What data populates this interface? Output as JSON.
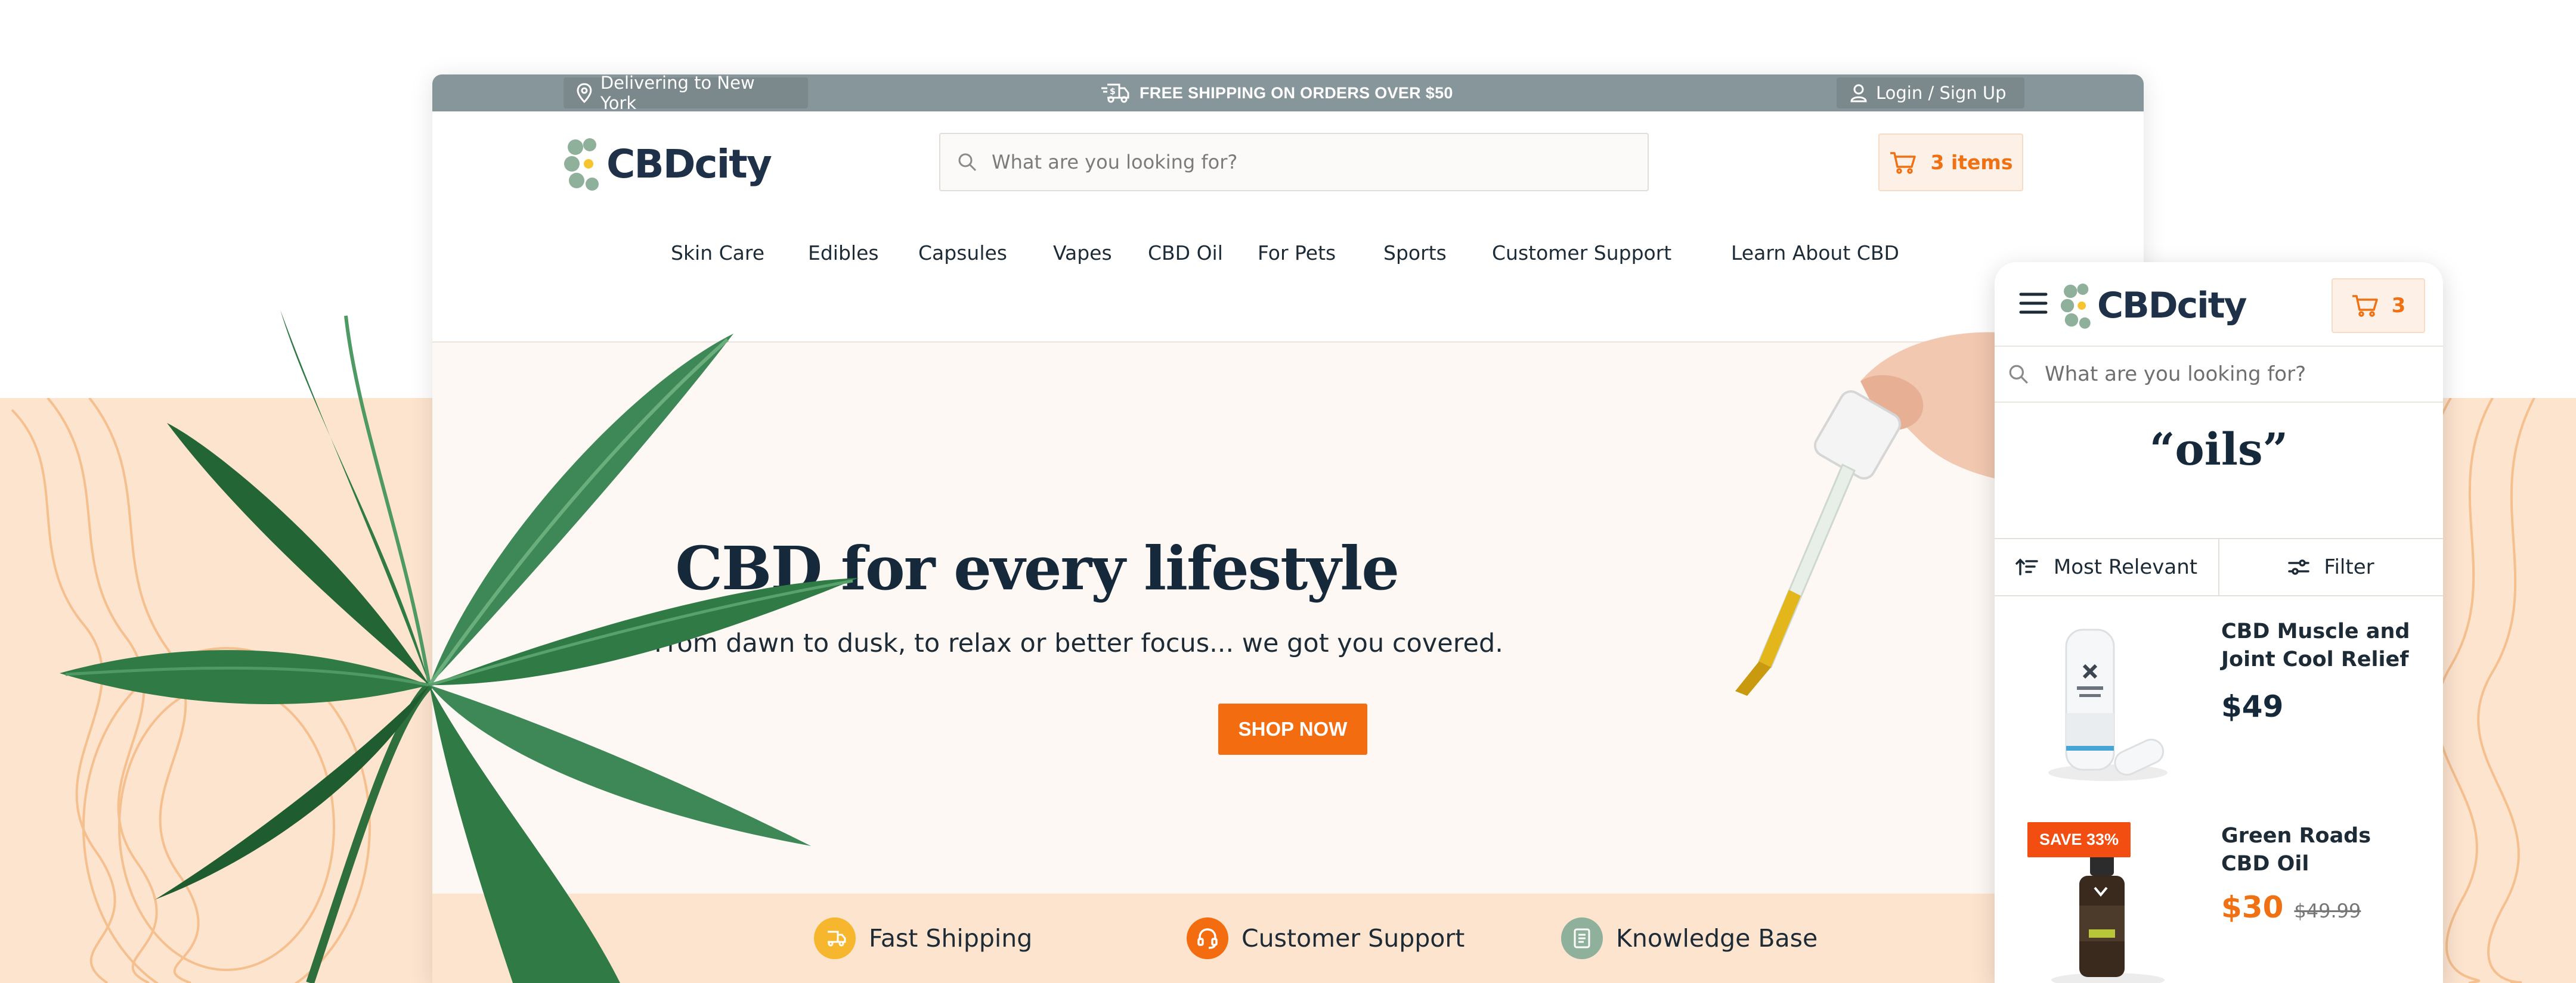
{
  "topbar": {
    "delivery_text": "Delivering to New York",
    "shipping_text": "FREE SHIPPING ON ORDERS OVER $50",
    "login_text": "Login / Sign Up"
  },
  "header": {
    "logo_text": "CBDcity",
    "search_placeholder": "What are you looking for?",
    "cart_label": "3 items"
  },
  "nav": {
    "items": [
      "Skin Care",
      "Edibles",
      "Capsules",
      "Vapes",
      "CBD Oil",
      "For Pets",
      "Sports",
      "Customer Support",
      "Learn About CBD"
    ]
  },
  "hero": {
    "title": "CBD for every lifestyle",
    "subtitle": "From dawn to dusk, to relax or better focus... we got you covered.",
    "button_label": "SHOP NOW"
  },
  "features": [
    {
      "label": "Fast Shipping",
      "icon": "truck-icon",
      "color": "#f6b72e"
    },
    {
      "label": "Customer Support",
      "icon": "headset-icon",
      "color": "#f36c10"
    },
    {
      "label": "Knowledge Base",
      "icon": "book-icon",
      "color": "#8fb09a"
    }
  ],
  "mobile": {
    "logo_text": "CBDcity",
    "cart_count": "3",
    "search_placeholder": "What are you looking for?",
    "query": "“oils”",
    "sort_label": "Most Relevant",
    "filter_label": "Filter",
    "products": [
      {
        "name": "CBD Muscle and Joint Cool Relief",
        "price": "$49"
      },
      {
        "name": "Green Roads CBD Oil",
        "price": "$30",
        "old_price": "$49.99",
        "badge": "SAVE 33%"
      }
    ]
  },
  "colors": {
    "accent": "#f36c10",
    "topbar": "#87969a",
    "peach": "#fde4cf",
    "navy": "#16293b"
  }
}
